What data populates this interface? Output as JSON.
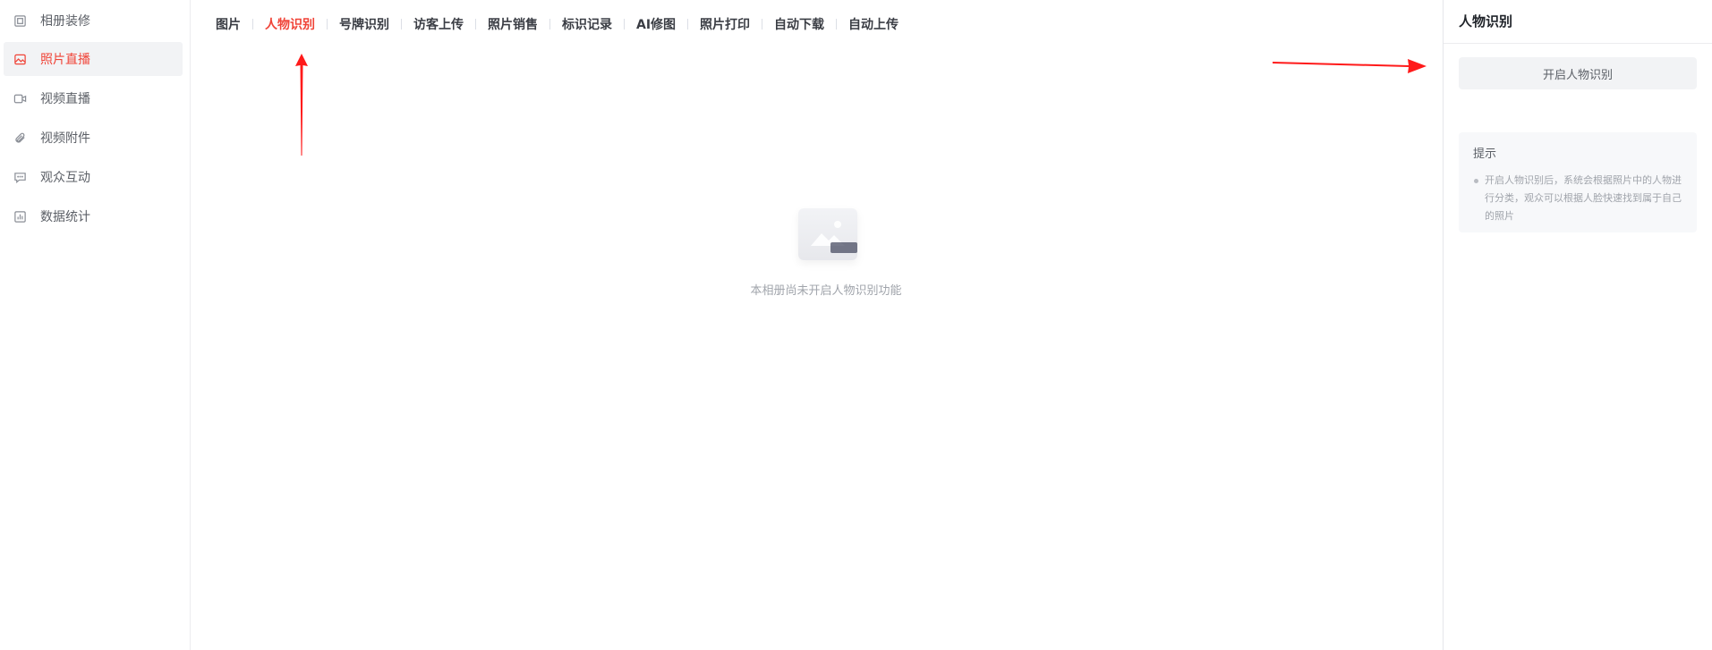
{
  "sidebar": {
    "items": [
      {
        "label": "相册装修",
        "icon": "frame-icon"
      },
      {
        "label": "照片直播",
        "icon": "image-icon"
      },
      {
        "label": "视频直播",
        "icon": "video-icon"
      },
      {
        "label": "视频附件",
        "icon": "paperclip-icon"
      },
      {
        "label": "观众互动",
        "icon": "chat-icon"
      },
      {
        "label": "数据统计",
        "icon": "chart-icon"
      }
    ],
    "active_index": 1
  },
  "tabs": [
    {
      "label": "图片"
    },
    {
      "label": "人物识别"
    },
    {
      "label": "号牌识别"
    },
    {
      "label": "访客上传"
    },
    {
      "label": "照片销售"
    },
    {
      "label": "标识记录"
    },
    {
      "label": "AI修图"
    },
    {
      "label": "照片打印"
    },
    {
      "label": "自动下载"
    },
    {
      "label": "自动上传"
    }
  ],
  "active_tab_index": 1,
  "main": {
    "empty_text": "本相册尚未开启人物识别功能"
  },
  "panel": {
    "title": "人物识别",
    "button_label": "开启人物识别",
    "tip_title": "提示",
    "tip_text": "开启人物识别后，系统会根据照片中的人物进行分类，观众可以根据人脸快速找到属于自己的照片"
  },
  "colors": {
    "accent": "#f04438",
    "annotation_arrow": "#ff1a1a"
  }
}
